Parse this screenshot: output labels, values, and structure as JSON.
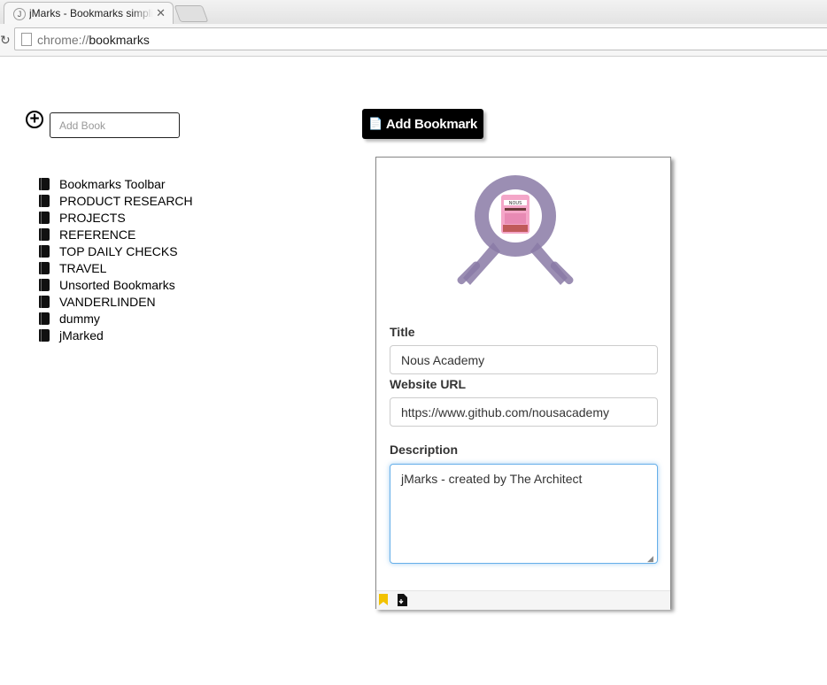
{
  "browser": {
    "tab_title": "jMarks - Bookmarks simplified",
    "tab_favicon": "J",
    "tab_close": "✕",
    "url_scheme": "chrome://",
    "url_path": "bookmarks"
  },
  "left": {
    "add_book_placeholder": "Add Book",
    "add_book_icon": "plus-circle-icon",
    "books": [
      "Bookmarks Toolbar",
      "PRODUCT RESEARCH",
      "PROJECTS",
      "REFERENCE",
      "TOP DAILY CHECKS",
      "TRAVEL",
      "Unsorted Bookmarks",
      "VANDERLINDEN",
      "dummy",
      "jMarked"
    ]
  },
  "form": {
    "add_bookmark_label": "Add Bookmark",
    "title_label": "Title",
    "title_value": "Nous Academy",
    "url_label": "Website URL",
    "url_value": "https://www.github.com/nousacademy",
    "description_label": "Description",
    "description_value": "jMarks - created by The Architect",
    "logo_text": "NOUS",
    "footer_icons": [
      "bookmark-flag-icon",
      "document-download-icon"
    ]
  },
  "colors": {
    "accent_focus": "#66afe9",
    "button_bg": "#000000",
    "logo_purple": "#8a7aa6",
    "logo_pink": "#f4a6c8",
    "bookmark_flag": "#f2c200"
  }
}
